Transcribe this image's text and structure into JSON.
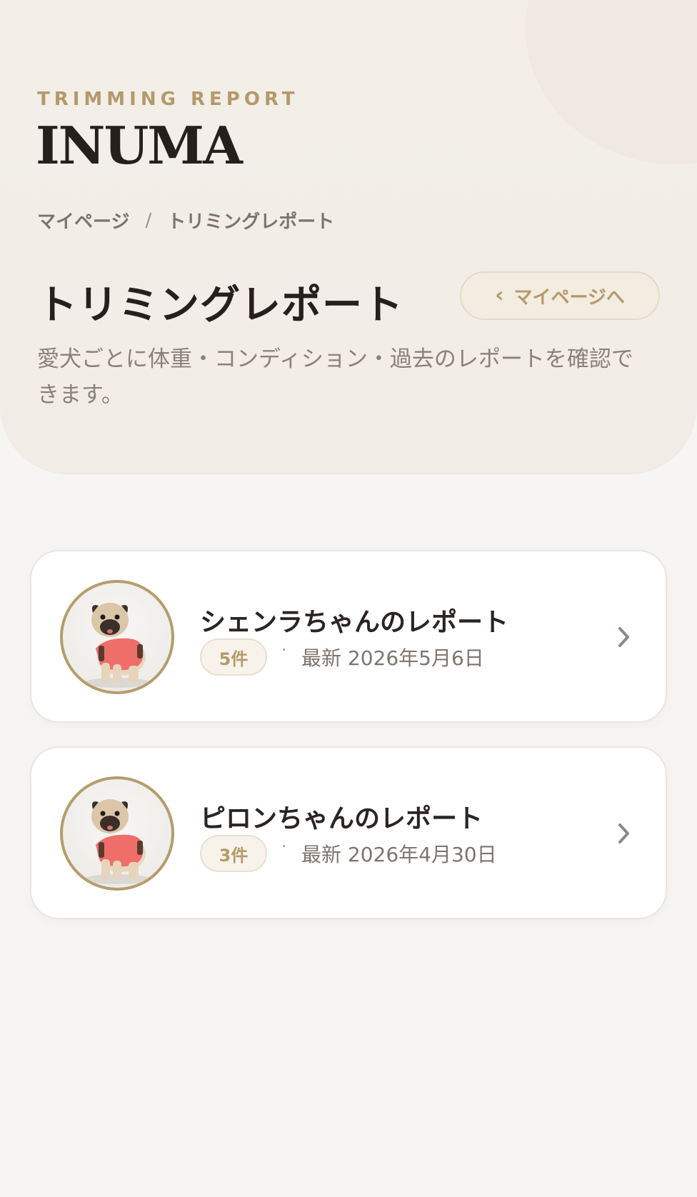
{
  "header": {
    "eyebrow": "TRIMMING REPORT",
    "brand": "INUMA"
  },
  "breadcrumb": {
    "items": [
      "マイページ",
      "トリミングレポート"
    ],
    "separator": "/"
  },
  "page": {
    "title": "トリミングレポート",
    "back_label": "マイページへ",
    "description": "愛犬ごとに体重・コンディション・過去のレポートを確認できます。"
  },
  "dogs": [
    {
      "title": "シェンラちゃんのレポート",
      "count": "5件",
      "separator": "·",
      "latest": "最新 2026年5月6日"
    },
    {
      "title": "ピロンちゃんのレポート",
      "count": "3件",
      "separator": "·",
      "latest": "最新 2026年4月30日"
    }
  ],
  "colors": {
    "accent": "#b49a6a",
    "text": "#26201c",
    "muted": "#8a817a",
    "background": "#f7f5f3"
  },
  "icons": [
    "chevron-left-icon",
    "chevron-right-icon"
  ]
}
